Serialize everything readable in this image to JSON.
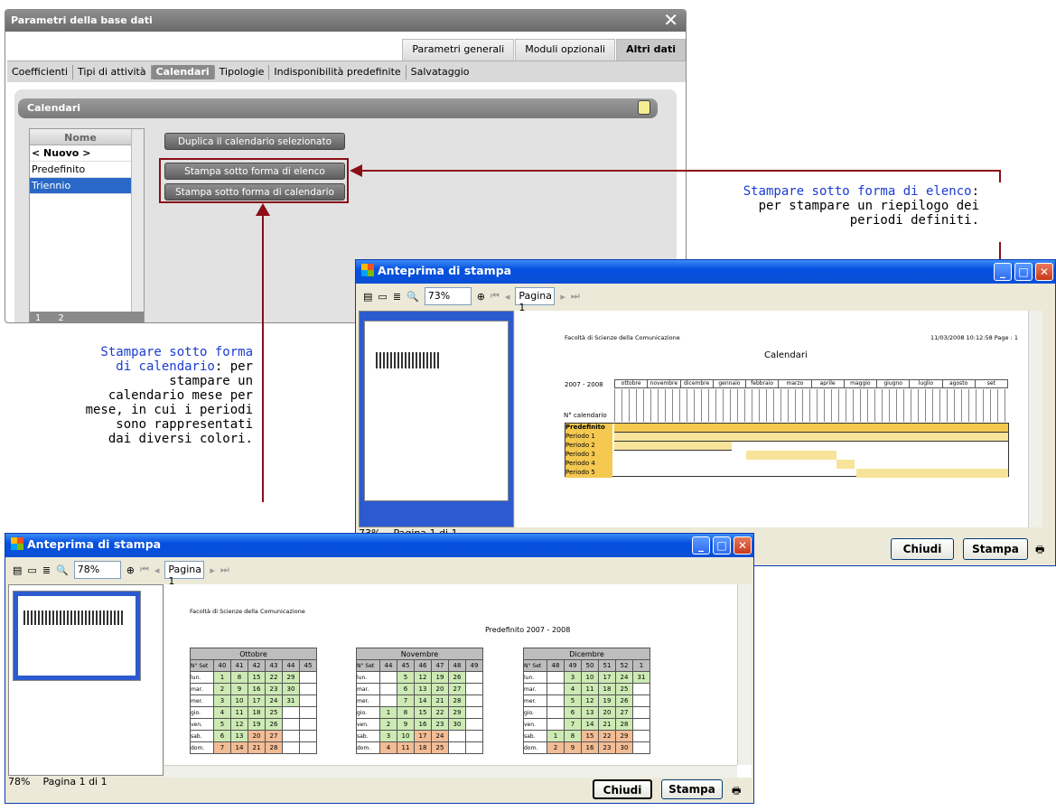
{
  "dialog": {
    "title": "Parametri della base dati",
    "top_tabs": [
      "Parametri generali",
      "Moduli opzionali",
      "Altri dati"
    ],
    "tabs": [
      "Coefficienti",
      "Tipi di attività",
      "Calendari",
      "Tipologie",
      "Indisponibilità predefinite",
      "Salvataggio"
    ],
    "section": "Calendari",
    "list_header": "Nome",
    "list_items": [
      "< Nuovo >",
      "Predefinito",
      "Triennio"
    ],
    "list_pages": [
      "1",
      "2"
    ],
    "btn_duplica": "Duplica il calendario selezionato",
    "btn_elenco": "Stampa sotto forma di elenco",
    "btn_calendario": "Stampa sotto forma di calendario"
  },
  "note1": {
    "highlight": "Stampare sotto forma di elenco",
    "rest1": ":",
    "line2": "per stampare un riepilogo dei",
    "line3": "periodi definiti."
  },
  "note2": {
    "l1": "Stampare sotto forma",
    "l2": "di calendario",
    "l2b": ": per",
    "l3": "stampare un",
    "l4": "calendario mese per",
    "l5": "mese, in cui i periodi",
    "l6": "sono rappresentati",
    "l7": "dai diversi colori."
  },
  "preview1": {
    "title": "Anteprima di stampa",
    "zoom": "73%",
    "page": "Pagina 1",
    "status_zoom": "73%",
    "status_page": "Pagina 1 di 1",
    "btn_close": "Chiudi",
    "btn_print": "Stampa",
    "doc_org": "Facoltà di Scienze della Comunicazione",
    "doc_date": "11/03/2008 10:12:58 Page : 1",
    "doc_title": "Calendari",
    "doc_year": "2007 - 2008",
    "months": [
      "ottobre",
      "novembre",
      "dicembre",
      "gennaio",
      "febbraio",
      "marzo",
      "aprile",
      "maggio",
      "giugno",
      "luglio",
      "agosto",
      "set"
    ],
    "n_cal": "N° calendario",
    "periods": [
      "Predefinito",
      "Periodo 1",
      "Periodo 2",
      "Periodo 3",
      "Periodo 4",
      "Periodo 5"
    ]
  },
  "preview2": {
    "title": "Anteprima di stampa",
    "zoom": "78%",
    "page": "Pagina 1",
    "status_zoom": "78%",
    "status_page": "Pagina 1 di 1",
    "btn_close": "Chiudi",
    "btn_print": "Stampa",
    "doc_org": "Facoltà di Scienze della Comunicazione",
    "doc_title": "Predefinito 2007 - 2008",
    "months": [
      {
        "name": "Ottobre",
        "weeks": [
          "N° Set",
          "40",
          "41",
          "42",
          "43",
          "44",
          "45"
        ],
        "rows": [
          [
            "lun.",
            "1",
            "8",
            "15",
            "22",
            "29",
            ""
          ],
          [
            "mar.",
            "2",
            "9",
            "16",
            "23",
            "30",
            ""
          ],
          [
            "mer.",
            "3",
            "10",
            "17",
            "24",
            "31",
            ""
          ],
          [
            "gio.",
            "4",
            "11",
            "18",
            "25",
            "",
            ""
          ],
          [
            "ven.",
            "5",
            "12",
            "19",
            "26",
            "",
            ""
          ],
          [
            "sab.",
            "6",
            "13",
            "20",
            "27",
            "",
            ""
          ],
          [
            "dom.",
            "7",
            "14",
            "21",
            "28",
            "",
            ""
          ]
        ]
      },
      {
        "name": "Novembre",
        "weeks": [
          "N° Set",
          "44",
          "45",
          "46",
          "47",
          "48",
          "49"
        ],
        "rows": [
          [
            "lun.",
            "",
            "5",
            "12",
            "19",
            "26",
            ""
          ],
          [
            "mar.",
            "",
            "6",
            "13",
            "20",
            "27",
            ""
          ],
          [
            "mer.",
            "",
            "7",
            "14",
            "21",
            "28",
            ""
          ],
          [
            "gio.",
            "1",
            "8",
            "15",
            "22",
            "29",
            ""
          ],
          [
            "ven.",
            "2",
            "9",
            "16",
            "23",
            "30",
            ""
          ],
          [
            "sab.",
            "3",
            "10",
            "17",
            "24",
            "",
            ""
          ],
          [
            "dom.",
            "4",
            "11",
            "18",
            "25",
            "",
            ""
          ]
        ]
      },
      {
        "name": "Dicembre",
        "weeks": [
          "N° Set",
          "48",
          "49",
          "50",
          "51",
          "52",
          "1"
        ],
        "rows": [
          [
            "lun.",
            "",
            "3",
            "10",
            "17",
            "24",
            "31"
          ],
          [
            "mar.",
            "",
            "4",
            "11",
            "18",
            "25",
            ""
          ],
          [
            "mer.",
            "",
            "5",
            "12",
            "19",
            "26",
            ""
          ],
          [
            "gio.",
            "",
            "6",
            "13",
            "20",
            "27",
            ""
          ],
          [
            "ven.",
            "",
            "7",
            "14",
            "21",
            "28",
            ""
          ],
          [
            "sab.",
            "1",
            "8",
            "15",
            "22",
            "29",
            ""
          ],
          [
            "dom.",
            "2",
            "9",
            "16",
            "23",
            "30",
            ""
          ]
        ]
      }
    ]
  }
}
